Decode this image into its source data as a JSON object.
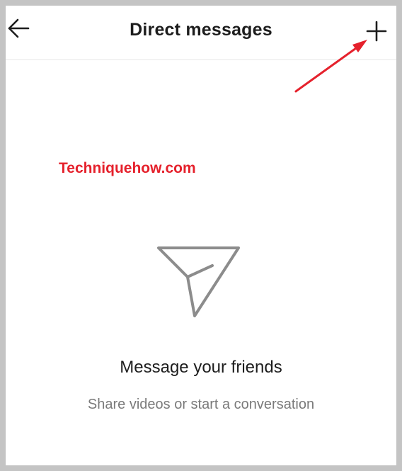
{
  "header": {
    "title": "Direct messages",
    "back_icon": "arrow-left-icon",
    "new_message_icon": "plus-icon"
  },
  "watermark": {
    "text": "Techniquehow.com",
    "color": "#e5212c"
  },
  "annotation": {
    "color": "#e5212c",
    "icon": "red-arrow-annotation"
  },
  "empty_state": {
    "icon": "paper-plane-icon",
    "title": "Message your friends",
    "subtitle": "Share videos or start a conversation"
  }
}
